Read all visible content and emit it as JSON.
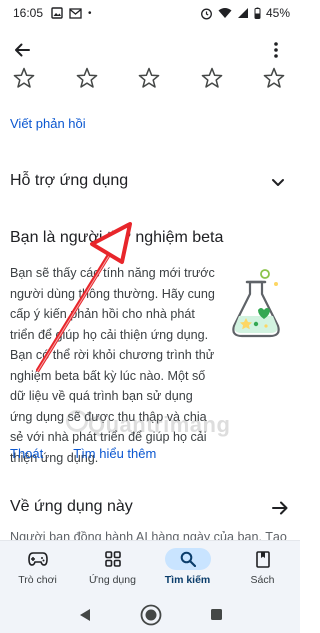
{
  "status_bar": {
    "time": "16:05",
    "battery": "45%"
  },
  "review": {
    "write_review_label": "Viết phản hồi"
  },
  "support": {
    "title": "Hỗ trợ ứng dụng"
  },
  "beta": {
    "title": "Bạn là người thử nghiệm beta",
    "description": "Bạn sẽ thấy các tính năng mới trước người dùng thông thường. Hãy cung cấp ý kiến phản hồi cho nhà phát triển để giúp họ cải thiện ứng dụng. Bạn có thể rời khỏi chương trình thử nghiệm beta bất kỳ lúc nào. Một số dữ liệu về quá trình bạn sử dụng ứng dụng sẽ được thu thập và chia sẻ với nhà phát triển để giúp họ cải thiện ứng dụng.",
    "leave_label": "Thoát",
    "learn_more_label": "Tìm hiểu thêm"
  },
  "watermark": "Quantrimang",
  "about": {
    "title": "Về ứng dụng này",
    "teaser": "Người bạn đồng hành AI hàng ngày của bạn. Tạo"
  },
  "bottom_nav": {
    "items": [
      {
        "label": "Trò chơi",
        "icon": "gamepad-icon",
        "active": false
      },
      {
        "label": "Ứng dụng",
        "icon": "apps-grid-icon",
        "active": false
      },
      {
        "label": "Tìm kiếm",
        "icon": "search-icon",
        "active": true
      },
      {
        "label": "Sách",
        "icon": "book-icon",
        "active": false
      }
    ]
  },
  "colors": {
    "accent": "#0b57d0",
    "nav_active_pill": "#c9e4ff",
    "annotation_arrow": "#e8262b"
  }
}
